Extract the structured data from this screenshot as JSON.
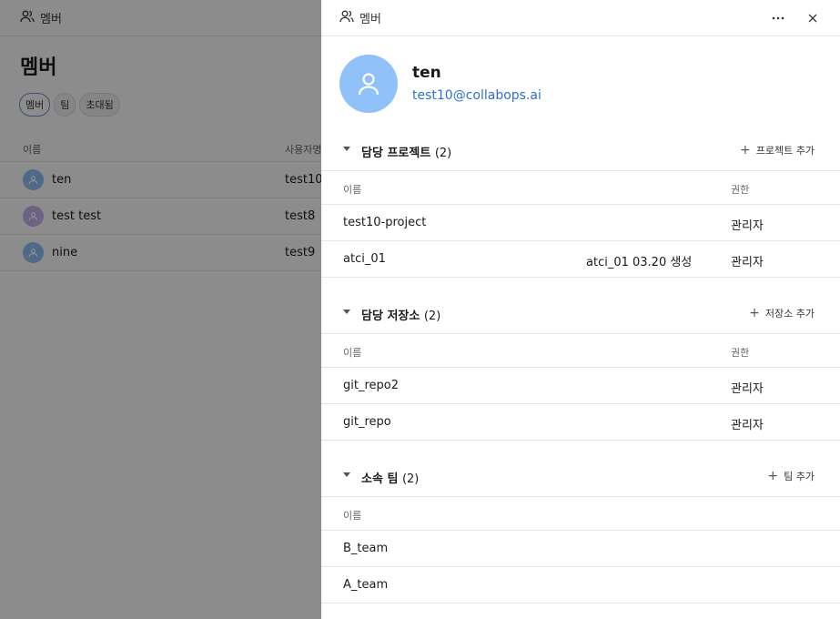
{
  "background": {
    "header_title": "멤버",
    "page_title": "멤버",
    "tabs": [
      {
        "label": "멤버",
        "active": true
      },
      {
        "label": "팀",
        "active": false
      },
      {
        "label": "초대됨",
        "active": false
      }
    ],
    "columns": {
      "name": "이름",
      "username": "사용자명"
    },
    "rows": [
      {
        "name": "ten",
        "username": "test10",
        "avatar_color": "#90c2f9"
      },
      {
        "name": "test test",
        "username": "test8",
        "avatar_color": "#c5b3f0"
      },
      {
        "name": "nine",
        "username": "test9",
        "avatar_color": "#90c2f9"
      }
    ]
  },
  "drawer": {
    "header_title": "멤버",
    "icons": {
      "header": "users-icon",
      "more": "more-horizontal-icon",
      "close": "close-icon"
    },
    "profile": {
      "name": "ten",
      "email": "test10@collabops.ai",
      "avatar_color": "#90c2f9"
    },
    "projects": {
      "title": "담당 프로젝트",
      "count": "(2)",
      "add_label": "프로젝트 추가",
      "col_name": "이름",
      "col_role": "권한",
      "items": [
        {
          "name": "test10-project",
          "description": "",
          "role": "관리자"
        },
        {
          "name": "atci_01",
          "description": "atci_01 03.20 생성",
          "role": "관리자"
        }
      ]
    },
    "repos": {
      "title": "담당 저장소",
      "count": "(2)",
      "add_label": "저장소 추가",
      "col_name": "이름",
      "col_role": "권한",
      "items": [
        {
          "name": "git_repo2",
          "role": "관리자"
        },
        {
          "name": "git_repo",
          "role": "관리자"
        }
      ]
    },
    "teams": {
      "title": "소속 팀",
      "count": "(2)",
      "add_label": "팀 추가",
      "col_name": "이름",
      "items": [
        {
          "name": "B_team"
        },
        {
          "name": "A_team"
        }
      ]
    }
  },
  "colors": {
    "accent": "#2f6fd6",
    "overlay": "rgba(0,0,0,0.45)"
  }
}
